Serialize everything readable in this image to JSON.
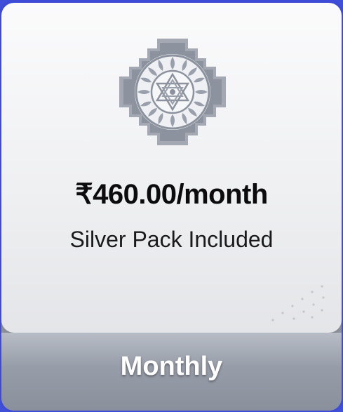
{
  "plan_card": {
    "price": "₹460.00/month",
    "subtitle": "Silver Pack Included",
    "plan_name": "Monthly",
    "emblem_icon": "yantra-emblem-icon"
  },
  "colors": {
    "frame": "#3f4fd8",
    "panel": "#f4f4f6",
    "emblem": "#9aa0ab",
    "band": "#979da8",
    "label": "#ffffff"
  }
}
